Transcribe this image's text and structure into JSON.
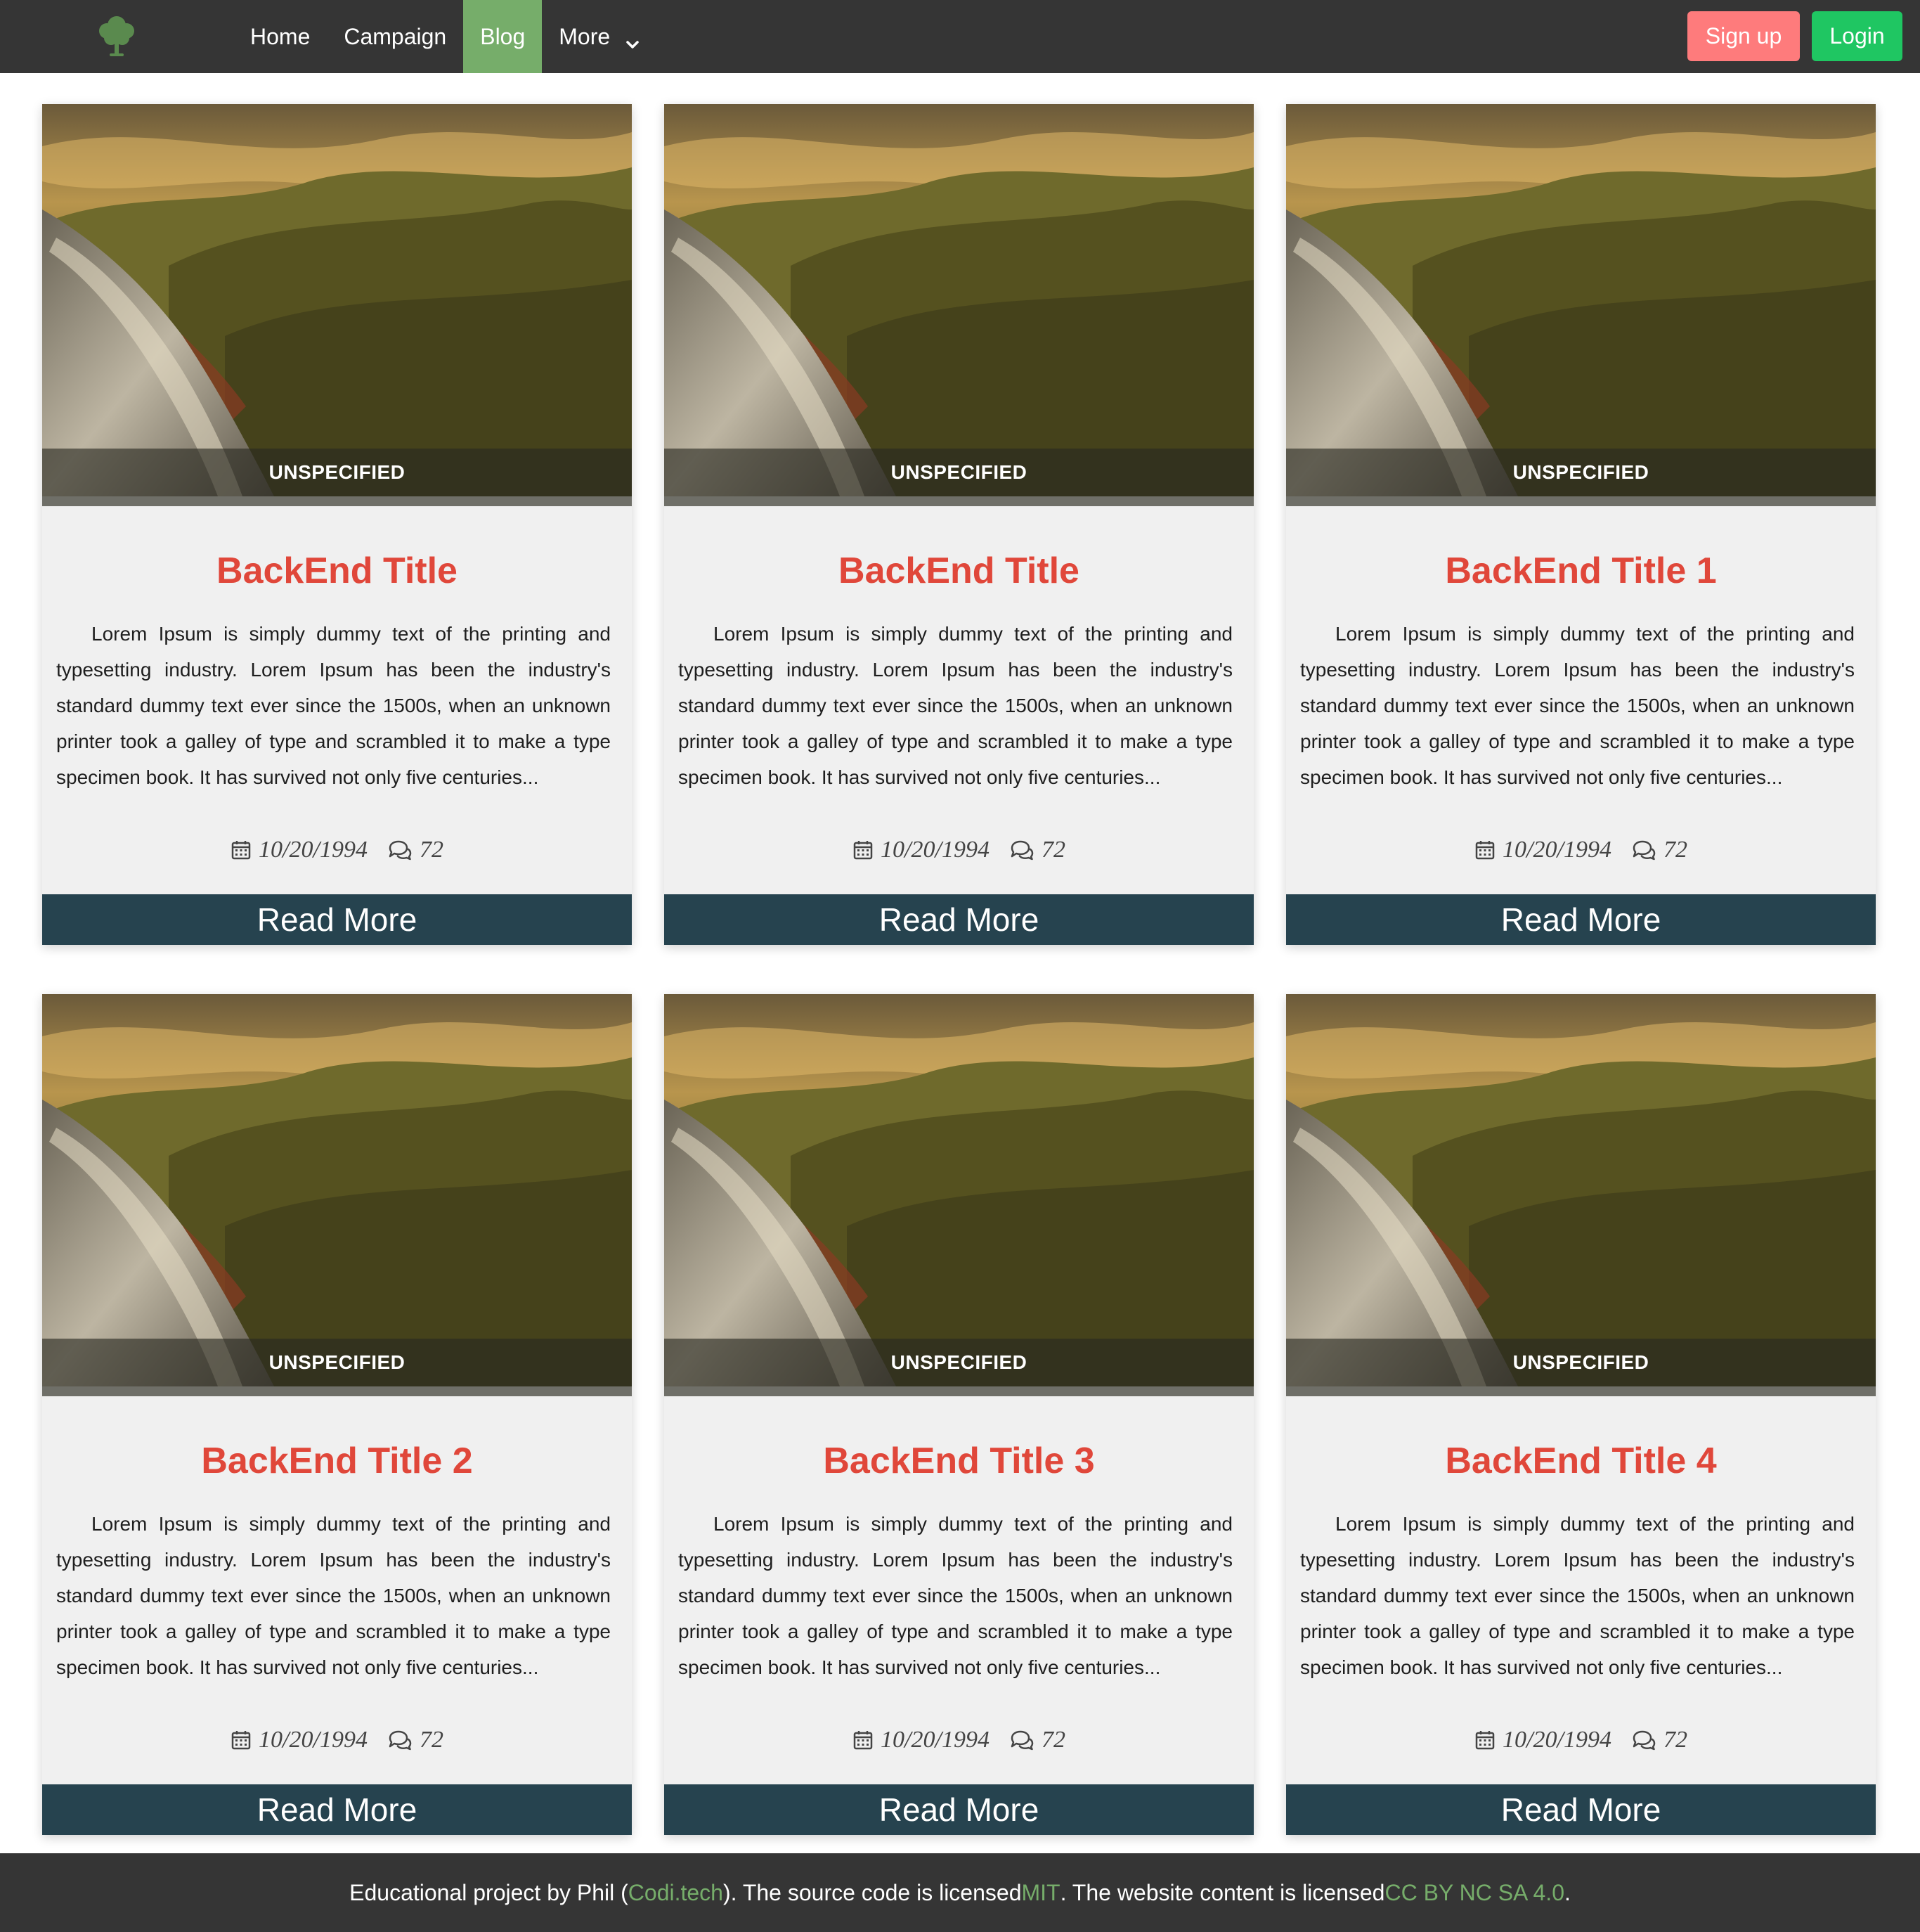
{
  "colors": {
    "navbar_bg": "#353535",
    "active_tab": "#76ad6a",
    "signup_bg": "#fe7b7c",
    "login_bg": "#1fc662",
    "title_red": "#e0473a",
    "read_more_bg": "#26434f",
    "footer_link": "#76ad6a"
  },
  "navbar": {
    "logo_icon": "tree-icon",
    "links": [
      {
        "label": "Home",
        "active": false
      },
      {
        "label": "Campaign",
        "active": false
      },
      {
        "label": "Blog",
        "active": true
      },
      {
        "label": "More",
        "active": false,
        "icon": "chevron-down-icon"
      }
    ],
    "signup_label": "Sign up",
    "login_label": "Login"
  },
  "cards": [
    {
      "category": "UNSPECIFIED",
      "title": "BackEnd Title",
      "excerpt": "Lorem Ipsum is simply dummy text of the printing and typesetting industry. Lorem Ipsum has been the industry's standard dummy text ever since the 1500s, when an unknown printer took a galley of type and scrambled it to make a type specimen book. It has survived not only five centuries...",
      "date": "10/20/1994",
      "comments": "72",
      "button": "Read More"
    },
    {
      "category": "UNSPECIFIED",
      "title": "BackEnd Title",
      "excerpt": "Lorem Ipsum is simply dummy text of the printing and typesetting industry. Lorem Ipsum has been the industry's standard dummy text ever since the 1500s, when an unknown printer took a galley of type and scrambled it to make a type specimen book. It has survived not only five centuries...",
      "date": "10/20/1994",
      "comments": "72",
      "button": "Read More"
    },
    {
      "category": "UNSPECIFIED",
      "title": "BackEnd Title 1",
      "excerpt": "Lorem Ipsum is simply dummy text of the printing and typesetting industry. Lorem Ipsum has been the industry's standard dummy text ever since the 1500s, when an unknown printer took a galley of type and scrambled it to make a type specimen book. It has survived not only five centuries...",
      "date": "10/20/1994",
      "comments": "72",
      "button": "Read More"
    },
    {
      "category": "UNSPECIFIED",
      "title": "BackEnd Title 2",
      "excerpt": "Lorem Ipsum is simply dummy text of the printing and typesetting industry. Lorem Ipsum has been the industry's standard dummy text ever since the 1500s, when an unknown printer took a galley of type and scrambled it to make a type specimen book. It has survived not only five centuries...",
      "date": "10/20/1994",
      "comments": "72",
      "button": "Read More"
    },
    {
      "category": "UNSPECIFIED",
      "title": "BackEnd Title 3",
      "excerpt": "Lorem Ipsum is simply dummy text of the printing and typesetting industry. Lorem Ipsum has been the industry's standard dummy text ever since the 1500s, when an unknown printer took a galley of type and scrambled it to make a type specimen book. It has survived not only five centuries...",
      "date": "10/20/1994",
      "comments": "72",
      "button": "Read More"
    },
    {
      "category": "UNSPECIFIED",
      "title": "BackEnd Title 4",
      "excerpt": "Lorem Ipsum is simply dummy text of the printing and typesetting industry. Lorem Ipsum has been the industry's standard dummy text ever since the 1500s, when an unknown printer took a galley of type and scrambled it to make a type specimen book. It has survived not only five centuries...",
      "date": "10/20/1994",
      "comments": "72",
      "button": "Read More"
    }
  ],
  "footer": {
    "text_1": "Educational project by Phil (",
    "link_1": "Codi.tech",
    "text_2": "). The source code is licensed ",
    "link_2": "MIT",
    "text_3": ". The website content is licensed ",
    "link_3": "CC BY NC SA 4.0",
    "text_4": "."
  }
}
